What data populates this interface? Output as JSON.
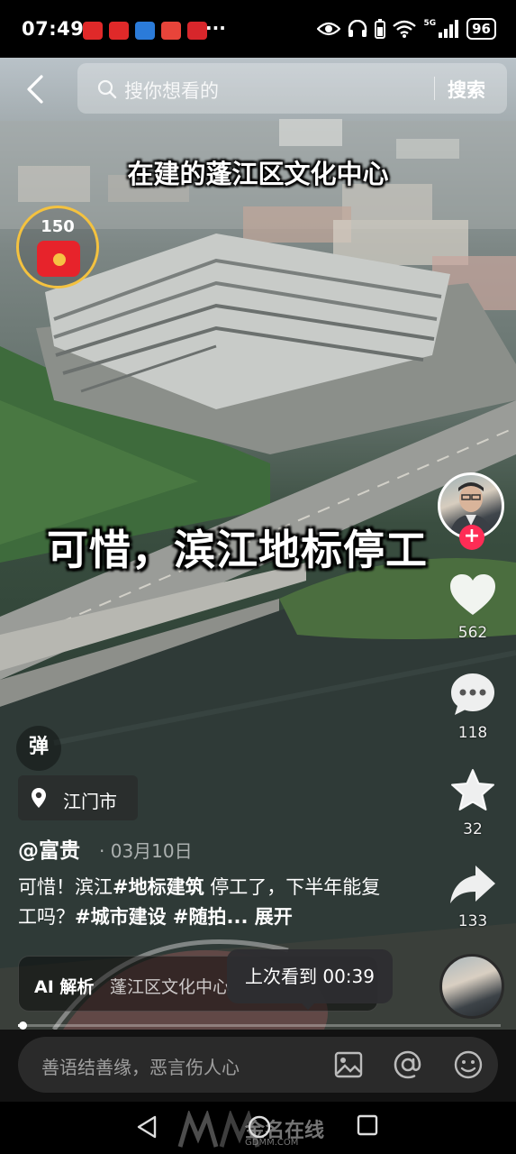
{
  "status_bar": {
    "time": "07:49",
    "more": "···",
    "network": "5G",
    "battery": "96"
  },
  "search": {
    "placeholder": "搜你想看的",
    "button_label": "搜索"
  },
  "video": {
    "caption_top": "在建的蓬江区文化中心",
    "caption_main": "可惜，滨江地标停工"
  },
  "red_packet": {
    "count": "150"
  },
  "actions": {
    "likes": "562",
    "comments": "118",
    "favorites": "32",
    "shares": "133"
  },
  "danmaku": {
    "label": "弹"
  },
  "location": {
    "name": "江门市"
  },
  "post": {
    "author": "@富贵",
    "date": "· 03月10日",
    "desc_part1": "可惜！滨江",
    "tag1": "#地标建筑",
    "desc_part2": " 停工了，下半年能复工吗？",
    "tag2": "#城市建设",
    "tag3": " #随拍...",
    "expand": " 展开"
  },
  "ai": {
    "label": "AI 解析",
    "text": "蓬江区文化中心"
  },
  "resume_tip": "上次看到 00:39",
  "progress": {
    "fraction": 0.01
  },
  "comment": {
    "placeholder": "善语结善缘，恶言伤人心"
  },
  "watermark": {
    "text": "GDMM.COM",
    "brand": "金名在线"
  },
  "icons": {
    "back": "back-arrow-icon",
    "search": "search-icon",
    "like": "heart-icon",
    "comment": "comment-icon",
    "favorite": "star-icon",
    "share": "share-icon",
    "location": "location-pin-icon",
    "image": "image-icon",
    "mention": "at-icon",
    "emoji": "emoji-icon"
  },
  "colors": {
    "accent": "#fe2c55",
    "gold": "#f4c23f",
    "red_packet": "#e7232b"
  }
}
